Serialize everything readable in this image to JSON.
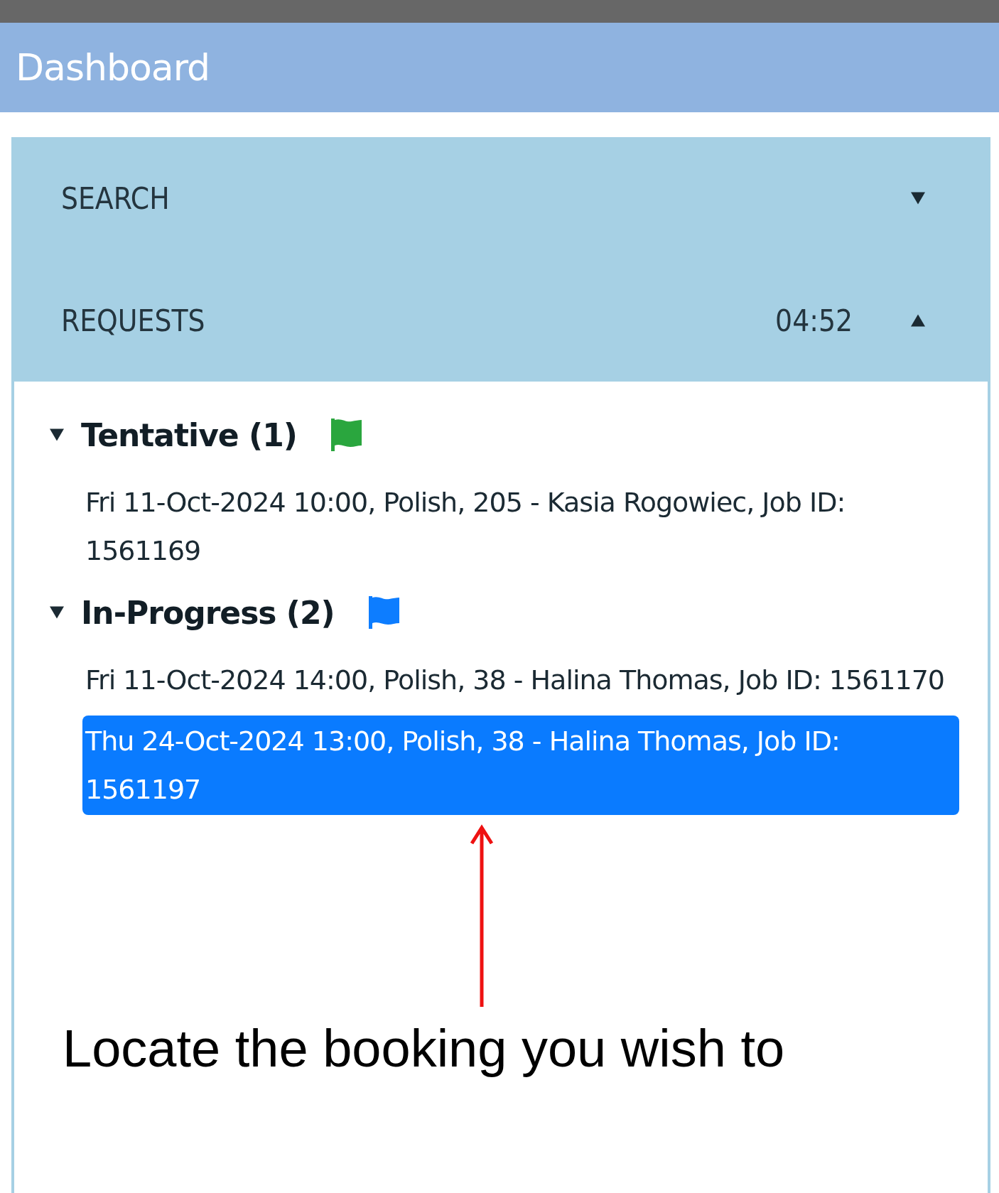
{
  "header": {
    "title": "Dashboard"
  },
  "sections": [
    {
      "title": "SEARCH",
      "expanded": false
    },
    {
      "title": "REQUESTS",
      "timer": "04:52",
      "expanded": true
    }
  ],
  "groups": [
    {
      "label": "Tentative (1)",
      "color": "#2aa63e",
      "expanded": true,
      "items": [
        {
          "text": "Fri 11-Oct-2024 10:00, Polish, 205 - Kasia Rogowiec, Job ID: 1561169",
          "selected": false
        }
      ]
    },
    {
      "label": "In-Progress (2)",
      "color": "#0d7dff",
      "expanded": true,
      "items": [
        {
          "text": "Fri 11-Oct-2024 14:00, Polish, 38 - Halina Thomas, Job ID: 1561170",
          "selected": false
        },
        {
          "text": "Thu 24-Oct-2024 13:00, Polish, 38 - Halina Thomas, Job ID: 1561197",
          "selected": true
        }
      ]
    }
  ],
  "annotation": {
    "text": "Locate the booking you wish to"
  }
}
